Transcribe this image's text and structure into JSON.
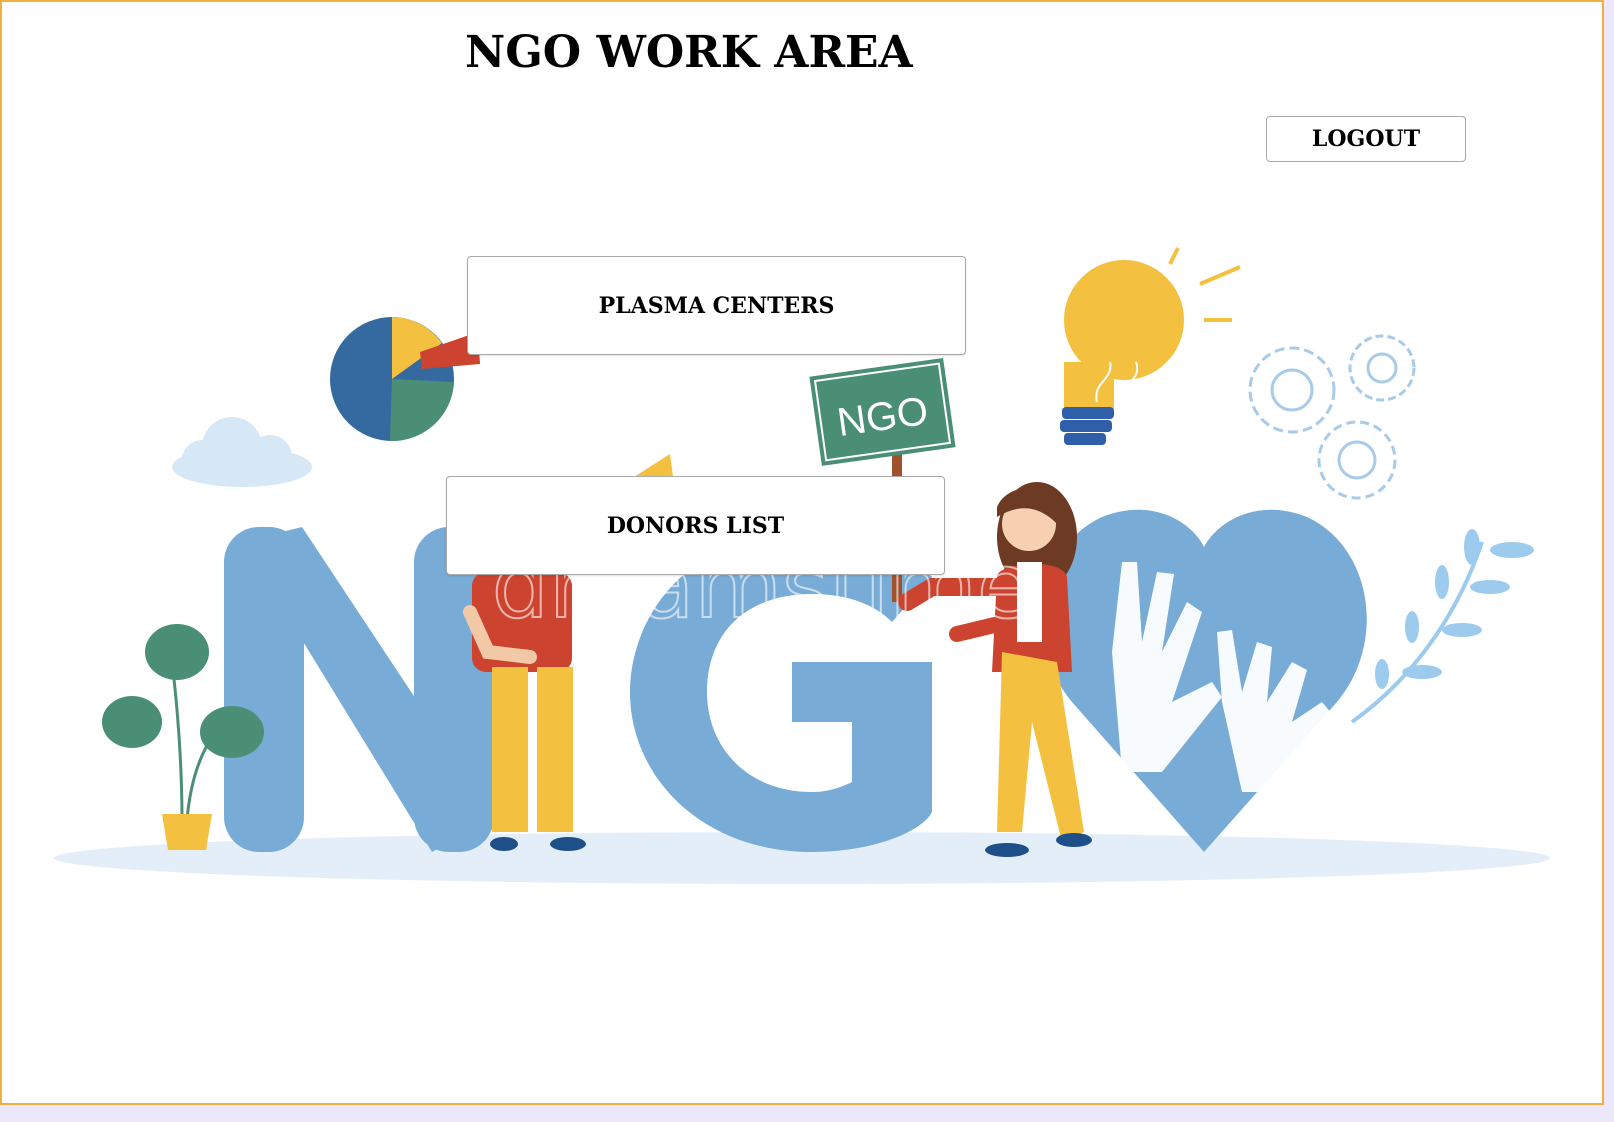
{
  "page": {
    "title": "NGO WORK AREA"
  },
  "actions": {
    "logout_label": "LOGOUT",
    "plasma_centers_label": "PLASMA CENTERS",
    "donors_list_label": "DONORS LIST"
  },
  "illustration": {
    "sign_text": "NGO",
    "big_letters": "NG",
    "watermark": "dreamstime"
  },
  "colors": {
    "frame_border": "#f0b040",
    "outer_background": "#ece8fa",
    "letters_blue": "#78acd6",
    "accent_yellow": "#f4c040",
    "accent_red": "#cc4430",
    "accent_green": "#4a8f75"
  },
  "icons": [
    "pie-chart-icon",
    "lightbulb-icon",
    "gear-icon",
    "heart-hands-icon",
    "plant-icon",
    "megaphone-icon"
  ]
}
